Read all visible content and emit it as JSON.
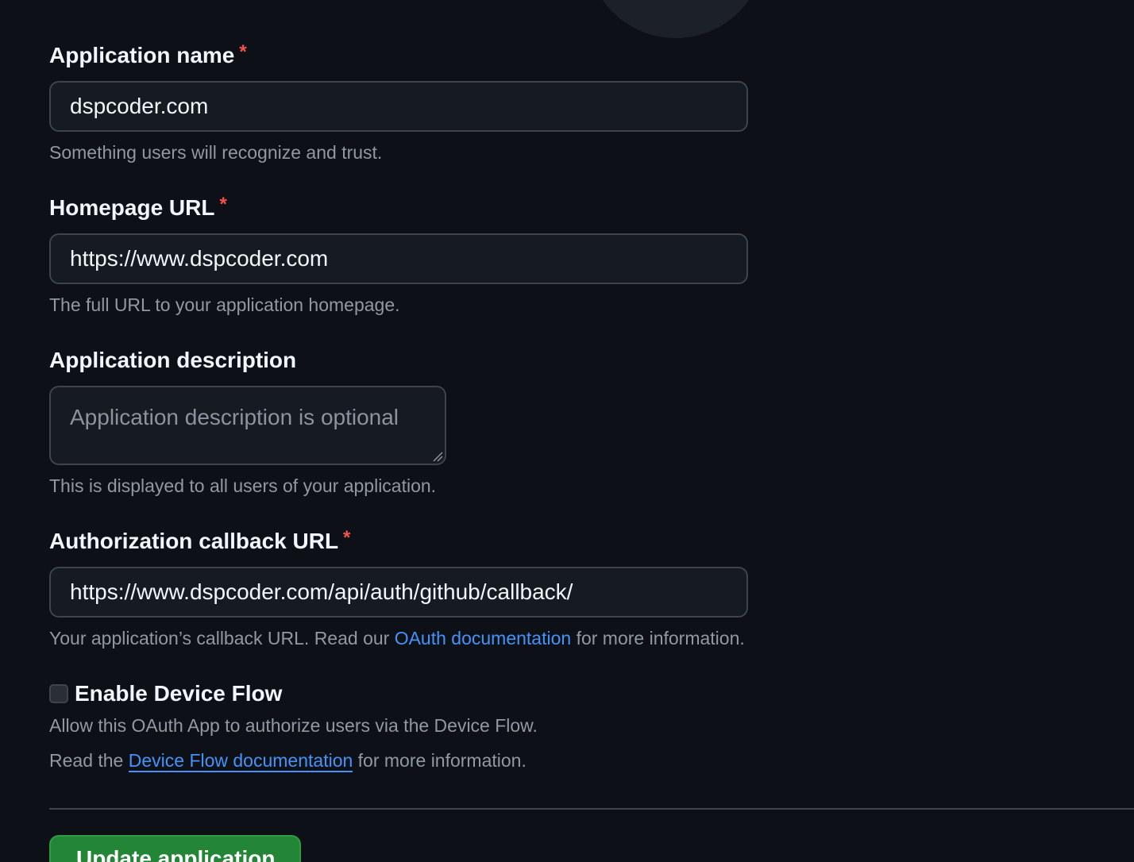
{
  "form": {
    "app_name": {
      "label": "Application name",
      "required_mark": "*",
      "value": "dspcoder.com",
      "note": "Something users will recognize and trust."
    },
    "homepage_url": {
      "label": "Homepage URL",
      "required_mark": "*",
      "value": "https://www.dspcoder.com",
      "note": "The full URL to your application homepage."
    },
    "description": {
      "label": "Application description",
      "placeholder": "Application description is optional",
      "note": "This is displayed to all users of your application."
    },
    "callback_url": {
      "label": "Authorization callback URL",
      "required_mark": "*",
      "value": "https://www.dspcoder.com/api/auth/github/callback/",
      "note_prefix": "Your application’s callback URL. Read our ",
      "note_link": "OAuth documentation",
      "note_suffix": " for more information."
    },
    "device_flow": {
      "label": "Enable Device Flow",
      "checked": false,
      "note": "Allow this OAuth App to authorize users via the Device Flow.",
      "note2_prefix": "Read the ",
      "note2_link": "Device Flow documentation",
      "note2_suffix": " for more information."
    },
    "submit_label": "Update application"
  },
  "colors": {
    "background": "#0d1117",
    "required": "#f85149",
    "link": "#4493f8",
    "primary_button": "#238636"
  }
}
